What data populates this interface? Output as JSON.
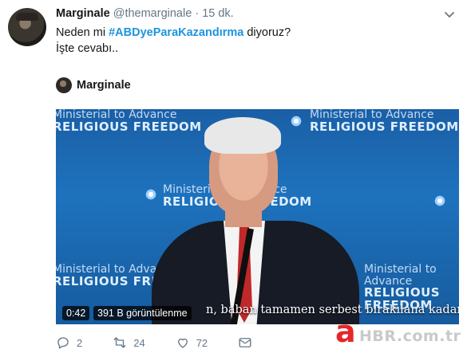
{
  "tweet": {
    "name": "Marginale",
    "handle": "@themarginale",
    "separator": "·",
    "time": "15 dk.",
    "line1_prefix": "Neden mi ",
    "hashtag": "#ABDyeParaKazandırma",
    "line1_suffix": " diyoruz?",
    "line2": "İşte cevabı.."
  },
  "embed": {
    "name": "Marginale"
  },
  "video": {
    "banners": [
      {
        "small": "Ministerial to Advance",
        "big": "RELIGIOUS FREEDOM"
      },
      {
        "small": "Ministerial to Advance",
        "big": "RELIGIOUS FREEDOM"
      },
      {
        "small": "Ministerial to Advance",
        "big": "RELIGIOUS FREEDOM"
      },
      {
        "small": "Ministerial to Advance",
        "big": "RELIGIOUS FREEDOM"
      },
      {
        "small": "Ministerial to Advance",
        "big": "RELIGIOUS FREEDOM"
      }
    ],
    "duration": "0:42",
    "views": "391 B görüntülenme",
    "subtitle": "n, baban tamamen serbest bırakılana kadar,"
  },
  "actions": {
    "replies": "2",
    "retweets": "24",
    "likes": "72"
  },
  "watermark": {
    "logo": "a",
    "text": "HBR.com.tr"
  },
  "colors": {
    "accent": "#1b95e0",
    "secondary_text": "#657786",
    "watermark_red": "#e4282a"
  }
}
